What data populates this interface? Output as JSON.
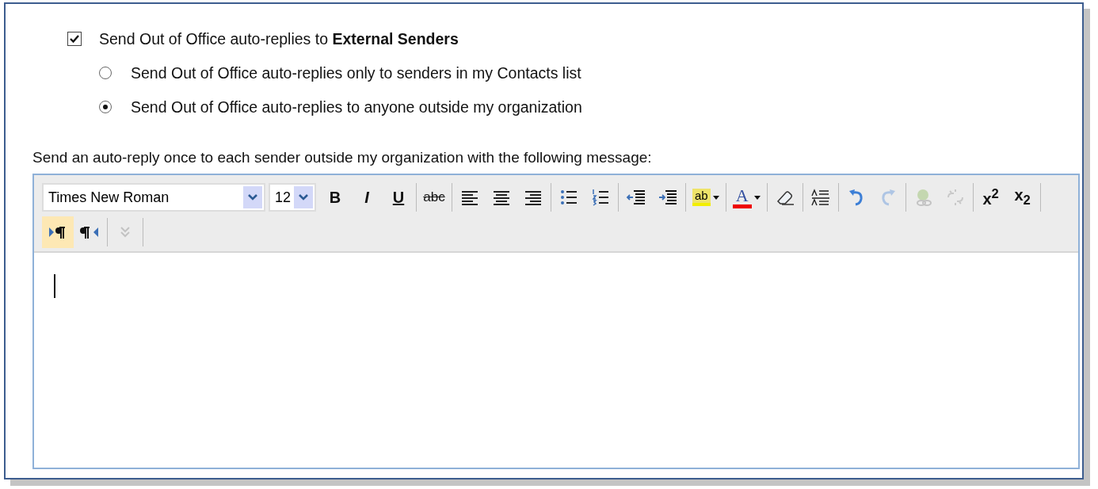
{
  "external": {
    "label": "Send Out of Office auto-replies to **External Senders**",
    "checked": true
  },
  "options": [
    {
      "label": "Send Out of Office auto-replies only to senders in my Contacts list",
      "selected": false
    },
    {
      "label": "Send Out of Office auto-replies to anyone outside my organization",
      "selected": true
    }
  ],
  "message_label": "Send an auto-reply once to each sender outside my organization with the following message:",
  "editor": {
    "font": "Times New Roman",
    "size": "12",
    "toolbar_rows": [
      [
        {
          "kind": "bold",
          "label": "B",
          "disabled": false,
          "selected": false
        },
        {
          "kind": "italic",
          "label": "I",
          "disabled": false,
          "selected": false
        },
        {
          "kind": "underline",
          "label": "U",
          "disabled": false,
          "selected": false
        },
        {
          "kind": "separator"
        },
        {
          "kind": "strike",
          "label": "abc",
          "disabled": false,
          "selected": false
        },
        {
          "kind": "separator"
        },
        {
          "kind": "align-left",
          "disabled": false,
          "selected": false
        },
        {
          "kind": "align-center",
          "disabled": false,
          "selected": false
        },
        {
          "kind": "align-right",
          "disabled": false,
          "selected": false
        },
        {
          "kind": "separator"
        },
        {
          "kind": "bullets",
          "disabled": false,
          "selected": false
        },
        {
          "kind": "numbering",
          "disabled": false,
          "selected": false
        },
        {
          "kind": "separator"
        },
        {
          "kind": "outdent",
          "disabled": false,
          "selected": false
        },
        {
          "kind": "indent",
          "disabled": false,
          "selected": false
        },
        {
          "kind": "separator"
        },
        {
          "kind": "highlight",
          "label": "ab",
          "disabled": false,
          "selected": false
        },
        {
          "kind": "separator"
        },
        {
          "kind": "font-color",
          "label": "A",
          "disabled": false,
          "selected": false
        },
        {
          "kind": "separator"
        },
        {
          "kind": "eraser",
          "disabled": false,
          "selected": false
        },
        {
          "kind": "separator"
        },
        {
          "kind": "spacing",
          "disabled": false,
          "selected": false
        },
        {
          "kind": "separator"
        },
        {
          "kind": "undo",
          "disabled": false,
          "selected": false
        },
        {
          "kind": "redo",
          "disabled": true,
          "selected": false
        },
        {
          "kind": "separator"
        },
        {
          "kind": "link",
          "disabled": true,
          "selected": false
        },
        {
          "kind": "unlink",
          "disabled": true,
          "selected": false
        },
        {
          "kind": "separator"
        },
        {
          "kind": "superscript",
          "label": "x$^{2}$",
          "disabled": false,
          "selected": false
        },
        {
          "kind": "subscript",
          "label": "x$_{2}$",
          "disabled": false,
          "selected": false
        },
        {
          "kind": "separator"
        }
      ],
      [
        {
          "kind": "ltr",
          "disabled": false,
          "selected": true
        },
        {
          "kind": "rtl",
          "disabled": false,
          "selected": false
        },
        {
          "kind": "separator"
        },
        {
          "kind": "more",
          "disabled": true,
          "selected": false
        },
        {
          "kind": "separator"
        }
      ]
    ]
  }
}
